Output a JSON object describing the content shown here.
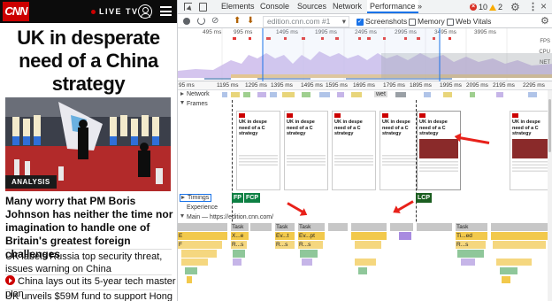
{
  "site": {
    "logo": "CNN",
    "live_tv": "LIVE TV",
    "headline": "UK in desperate need of a China strategy",
    "tag": "ANALYSIS",
    "main_story": "Many worry that PM Boris Johnson has neither the time nor imagination to handle one of Britain's greatest foreign challenges",
    "stories": [
      "UK labels Russia top security threat, issues warning on China",
      "China lays out its 5-year tech master plan",
      "UK unveils $59M fund to support Hong"
    ],
    "colors": {
      "brand": "#cc0000",
      "topbar": "#0c0c0c"
    }
  },
  "devtools": {
    "tabs": [
      "Elements",
      "Console",
      "Sources",
      "Network",
      "Performance",
      "»"
    ],
    "active_tab": "Performance",
    "errors": "10",
    "warnings": "2",
    "icons": [
      "inspect-icon",
      "device-toolbar-icon",
      "gear-icon",
      "kebab-menu-icon",
      "close-icon"
    ],
    "toolbar": {
      "recording": "edition.cnn.com #1",
      "screenshots_label": "Screenshots",
      "screenshots_checked": true,
      "memory_label": "Memory",
      "memory_checked": false,
      "webvitals_label": "Web Vitals",
      "webvitals_checked": false
    },
    "overview_ticks": [
      "495 ms",
      "995 ms",
      "1495 ms",
      "1995 ms",
      "2495 ms",
      "2995 ms",
      "3495 ms",
      "3995 ms"
    ],
    "overview_labels": [
      "FPS",
      "CPU",
      "NET"
    ],
    "ruler_ticks": [
      "95 ms",
      "1195 ms",
      "1295 ms",
      "1395 ms",
      "1495 ms",
      "1595 ms",
      "1695 ms",
      "1795 ms",
      "1895 ms",
      "1995 ms",
      "2095 ms",
      "2195 ms",
      "2295 ms"
    ],
    "tracks": {
      "network": "Network",
      "network_item": "wet",
      "frames": "Frames",
      "timings": "Timings",
      "experience": "Experience",
      "main": "Main — https://edition.cnn.com/"
    },
    "shot_text": "UK in despe need of a C strategy",
    "markers": {
      "fp": "FP",
      "fcp": "FCP",
      "lcp": "LCP"
    },
    "flame": {
      "task": "Task",
      "ev": "Ev...t",
      "xe": "X...e",
      "evpt": "Ev...pt",
      "tied": "Ti...ed",
      "rs": "R...s",
      "e": "E",
      "f": "F"
    }
  }
}
